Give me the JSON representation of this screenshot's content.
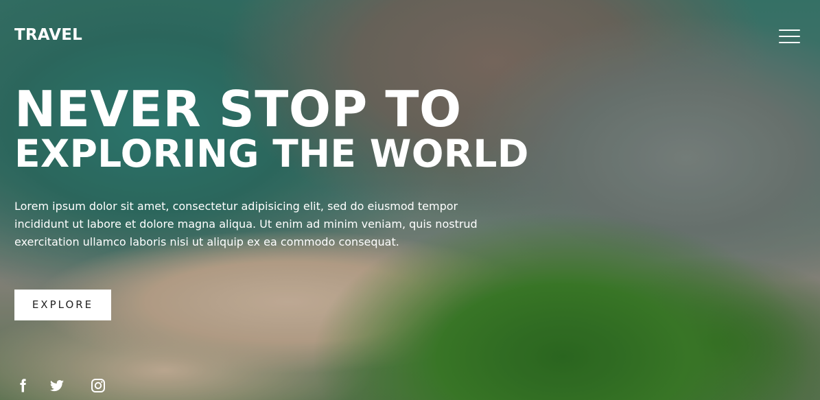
{
  "nav": {
    "brand": "TRAVEL",
    "menu_icon": "hamburger-menu-icon"
  },
  "hero": {
    "headline_line1": "NEVER STOP TO",
    "headline_line2": "EXPLORING THE WORLD",
    "description": "Lorem ipsum dolor sit amet, consectetur adipisicing elit, sed do eiusmod tempor incididunt ut labore et dolore magna aliqua. Ut enim ad minim veniam, quis nostrud exercitation ullamco laboris nisi ut aliquip ex ea commodo consequat.",
    "cta_label": "EXPLORE"
  },
  "social": [
    {
      "icon": "facebook-icon"
    },
    {
      "icon": "twitter-icon"
    },
    {
      "icon": "instagram-icon"
    }
  ],
  "colors": {
    "text": "#ffffff",
    "button_bg": "#ffffff",
    "button_text": "#222222"
  }
}
